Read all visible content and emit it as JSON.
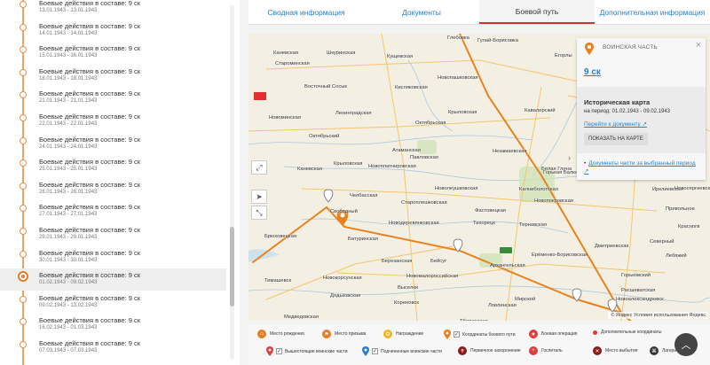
{
  "timeline": {
    "items": [
      {
        "title": "Боевые действия в составе: 9 ск",
        "date": "13.01.1943 - 13.01.1943"
      },
      {
        "title": "Боевые действия в составе: 9 ск",
        "date": "14.01.1943 - 14.01.1943"
      },
      {
        "title": "Боевые действия в составе: 9 ск",
        "date": "15.01.1943 - 16.01.1943"
      },
      {
        "title": "Боевые действия в составе: 9 ск",
        "date": "18.01.1943 - 18.01.1943"
      },
      {
        "title": "Боевые действия в составе: 9 ск",
        "date": "21.01.1943 - 21.01.1943"
      },
      {
        "title": "Боевые действия в составе: 9 ск",
        "date": "22.01.1943 - 22.01.1943"
      },
      {
        "title": "Боевые действия в составе: 9 ск",
        "date": "24.01.1943 - 24.01.1943"
      },
      {
        "title": "Боевые действия в составе: 9 ск",
        "date": "25.01.1943 - 25.01.1943"
      },
      {
        "title": "Боевые действия в составе: 9 ск",
        "date": "26.01.1943 - 26.01.1943"
      },
      {
        "title": "Боевые действия в составе: 9 ск",
        "date": "27.01.1943 - 27.01.1943"
      },
      {
        "title": "Боевые действия в составе: 9 ск",
        "date": "29.01.1943 - 29.01.1943"
      },
      {
        "title": "Боевые действия в составе: 9 ск",
        "date": "30.01.1943 - 30.01.1943"
      },
      {
        "title": "Боевые действия в составе: 9 ск",
        "date": "01.02.1943 - 09.02.1943",
        "active": true
      },
      {
        "title": "Боевые действия в составе: 9 ск",
        "date": "09.02.1943 - 13.02.1943"
      },
      {
        "title": "Боевые действия в составе: 9 ск",
        "date": "16.02.1943 - 01.03.1943"
      },
      {
        "title": "Боевые действия в составе: 9 ск",
        "date": "07.03.1943 - 07.03.1943"
      }
    ]
  },
  "tabs": [
    {
      "label": "Сводная информация"
    },
    {
      "label": "Документы"
    },
    {
      "label": "Боевой путь",
      "active": true
    },
    {
      "label": "Дополнительная информация"
    }
  ],
  "map": {
    "route_color": "#e8821e",
    "cities": [
      {
        "name": "Глебовка"
      },
      {
        "name": "Гулай-Борисовка"
      },
      {
        "name": "Каневская"
      },
      {
        "name": "Шкуринская"
      },
      {
        "name": "Кущевская"
      },
      {
        "name": "Староминская"
      },
      {
        "name": "Егорлы"
      },
      {
        "name": "Восточный Сосык"
      },
      {
        "name": "Кисляковская"
      },
      {
        "name": "Новопашковская"
      },
      {
        "name": "Новоминская"
      },
      {
        "name": "Ленинградская"
      },
      {
        "name": "Крыловская"
      },
      {
        "name": "Кавалерский"
      },
      {
        "name": "Октябрьская"
      },
      {
        "name": "Октябрьский"
      },
      {
        "name": "Атаманская"
      },
      {
        "name": "Незамаевская"
      },
      {
        "name": "Павловская"
      },
      {
        "name": "Каневская"
      },
      {
        "name": "Крыловская"
      },
      {
        "name": "Новоплатнировская"
      },
      {
        "name": "Белая Глина"
      },
      {
        "name": "Горькая Балка"
      },
      {
        "name": "Новолеушковская"
      },
      {
        "name": "Калниболотская"
      },
      {
        "name": "Челбасская"
      },
      {
        "name": "Новопокровская"
      },
      {
        "name": "Староплешковская"
      },
      {
        "name": "Фастовецкая"
      },
      {
        "name": "Свободный"
      },
      {
        "name": "Брюховецкая"
      },
      {
        "name": "Новодеревянковская"
      },
      {
        "name": "Тихорецк"
      },
      {
        "name": "Терновская"
      },
      {
        "name": "Батуринская"
      },
      {
        "name": "Архангельская"
      },
      {
        "name": "Ерёменко-Борисовская"
      },
      {
        "name": "Березанская"
      },
      {
        "name": "Бейсуг"
      },
      {
        "name": "Дмитриевская"
      },
      {
        "name": "Тимашевск"
      },
      {
        "name": "Новокорсунская"
      },
      {
        "name": "Новомалороссийская"
      },
      {
        "name": "Горьковский"
      },
      {
        "name": "Расшеватская"
      },
      {
        "name": "Выселки"
      },
      {
        "name": "Мирской"
      },
      {
        "name": "Дядьковская"
      },
      {
        "name": "Кореновск"
      },
      {
        "name": "Ловлинская"
      },
      {
        "name": "Новоалександровск"
      },
      {
        "name": "Медведовская"
      },
      {
        "name": "Тбилисская"
      },
      {
        "name": "Красногв"
      },
      {
        "name": "Привольное"
      },
      {
        "name": "Ирклиевская"
      },
      {
        "name": "Лебяжий"
      },
      {
        "name": "Северный"
      },
      {
        "name": "Новосергиевская"
      }
    ],
    "copyright": "© Яндекс Условия использования Яндекс"
  },
  "info": {
    "type_label": "ВОИНСКАЯ ЧАСТЬ",
    "unit": "9 ск",
    "hist_title": "Историческая карта",
    "hist_period": "на период: 01.02.1943 - 09.02.1943",
    "go_doc": "Перейти к документу ↗",
    "show_btn": "ПОКАЗАТЬ НА КАРТЕ",
    "docs_link": "Документы части за выбранный период ↗"
  },
  "legend": {
    "items": [
      {
        "label": "Место рождения",
        "color": "#e67e22",
        "icon": "house-icon"
      },
      {
        "label": "Место призыва",
        "color": "#e67e22",
        "icon": "flag-icon"
      },
      {
        "label": "Награждение",
        "color": "#f1b51c",
        "icon": "medal-icon"
      },
      {
        "label": "Координаты боевого пути",
        "color": "#e67e22",
        "icon": "pin-icon"
      },
      {
        "label": "Боевая операция",
        "color": "#e03c3c",
        "icon": "star-icon"
      },
      {
        "label": "Дополнительные координаты",
        "color": "#e03c3c",
        "icon": "dot-icon"
      },
      {
        "label": "Вышестоящие воинские части",
        "color": "#e03c3c",
        "icon": "pin-icon"
      },
      {
        "label": "Подчиненные воинские части",
        "color": "#2a7fc4",
        "icon": "pin-icon"
      },
      {
        "label": "Первичное захоронение",
        "color": "#8b1a1a",
        "icon": "cross-icon"
      },
      {
        "label": "Госпиталь",
        "color": "#e03c3c",
        "icon": "plus-icon"
      },
      {
        "label": "Место выбытия",
        "color": "#8b1a1a",
        "icon": "x-icon"
      },
      {
        "label": "Лагерь",
        "color": "#333333",
        "icon": "camp-icon"
      }
    ]
  }
}
